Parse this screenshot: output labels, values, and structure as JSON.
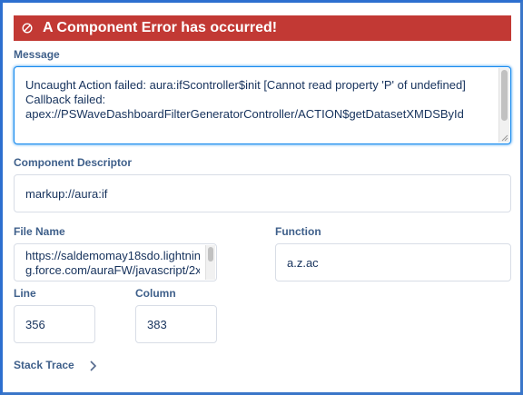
{
  "banner": {
    "title": "A Component Error has occurred!",
    "icon": "error-circle-slash-icon",
    "color": "#c23934"
  },
  "message": {
    "label": "Message",
    "line1": "Uncaught Action failed: aura:ifScontroller$init [Cannot read property 'P' of undefined]",
    "line2": "Callback failed:",
    "line3": "apex://PSWaveDashboardFilterGeneratorController/ACTION$getDatasetXMDSById"
  },
  "descriptor": {
    "label": "Component Descriptor",
    "value": "markup://aura:if"
  },
  "file": {
    "label": "File Name",
    "line1": "https://saldemomay18sdo.lightnin",
    "line2": "g.force.com/auraFW/javascript/2x"
  },
  "function": {
    "label": "Function",
    "value": "a.z.ac"
  },
  "line": {
    "label": "Line",
    "value": "356"
  },
  "column": {
    "label": "Column",
    "value": "383"
  },
  "stack": {
    "label": "Stack Trace",
    "icon": "chevron-right-icon"
  }
}
